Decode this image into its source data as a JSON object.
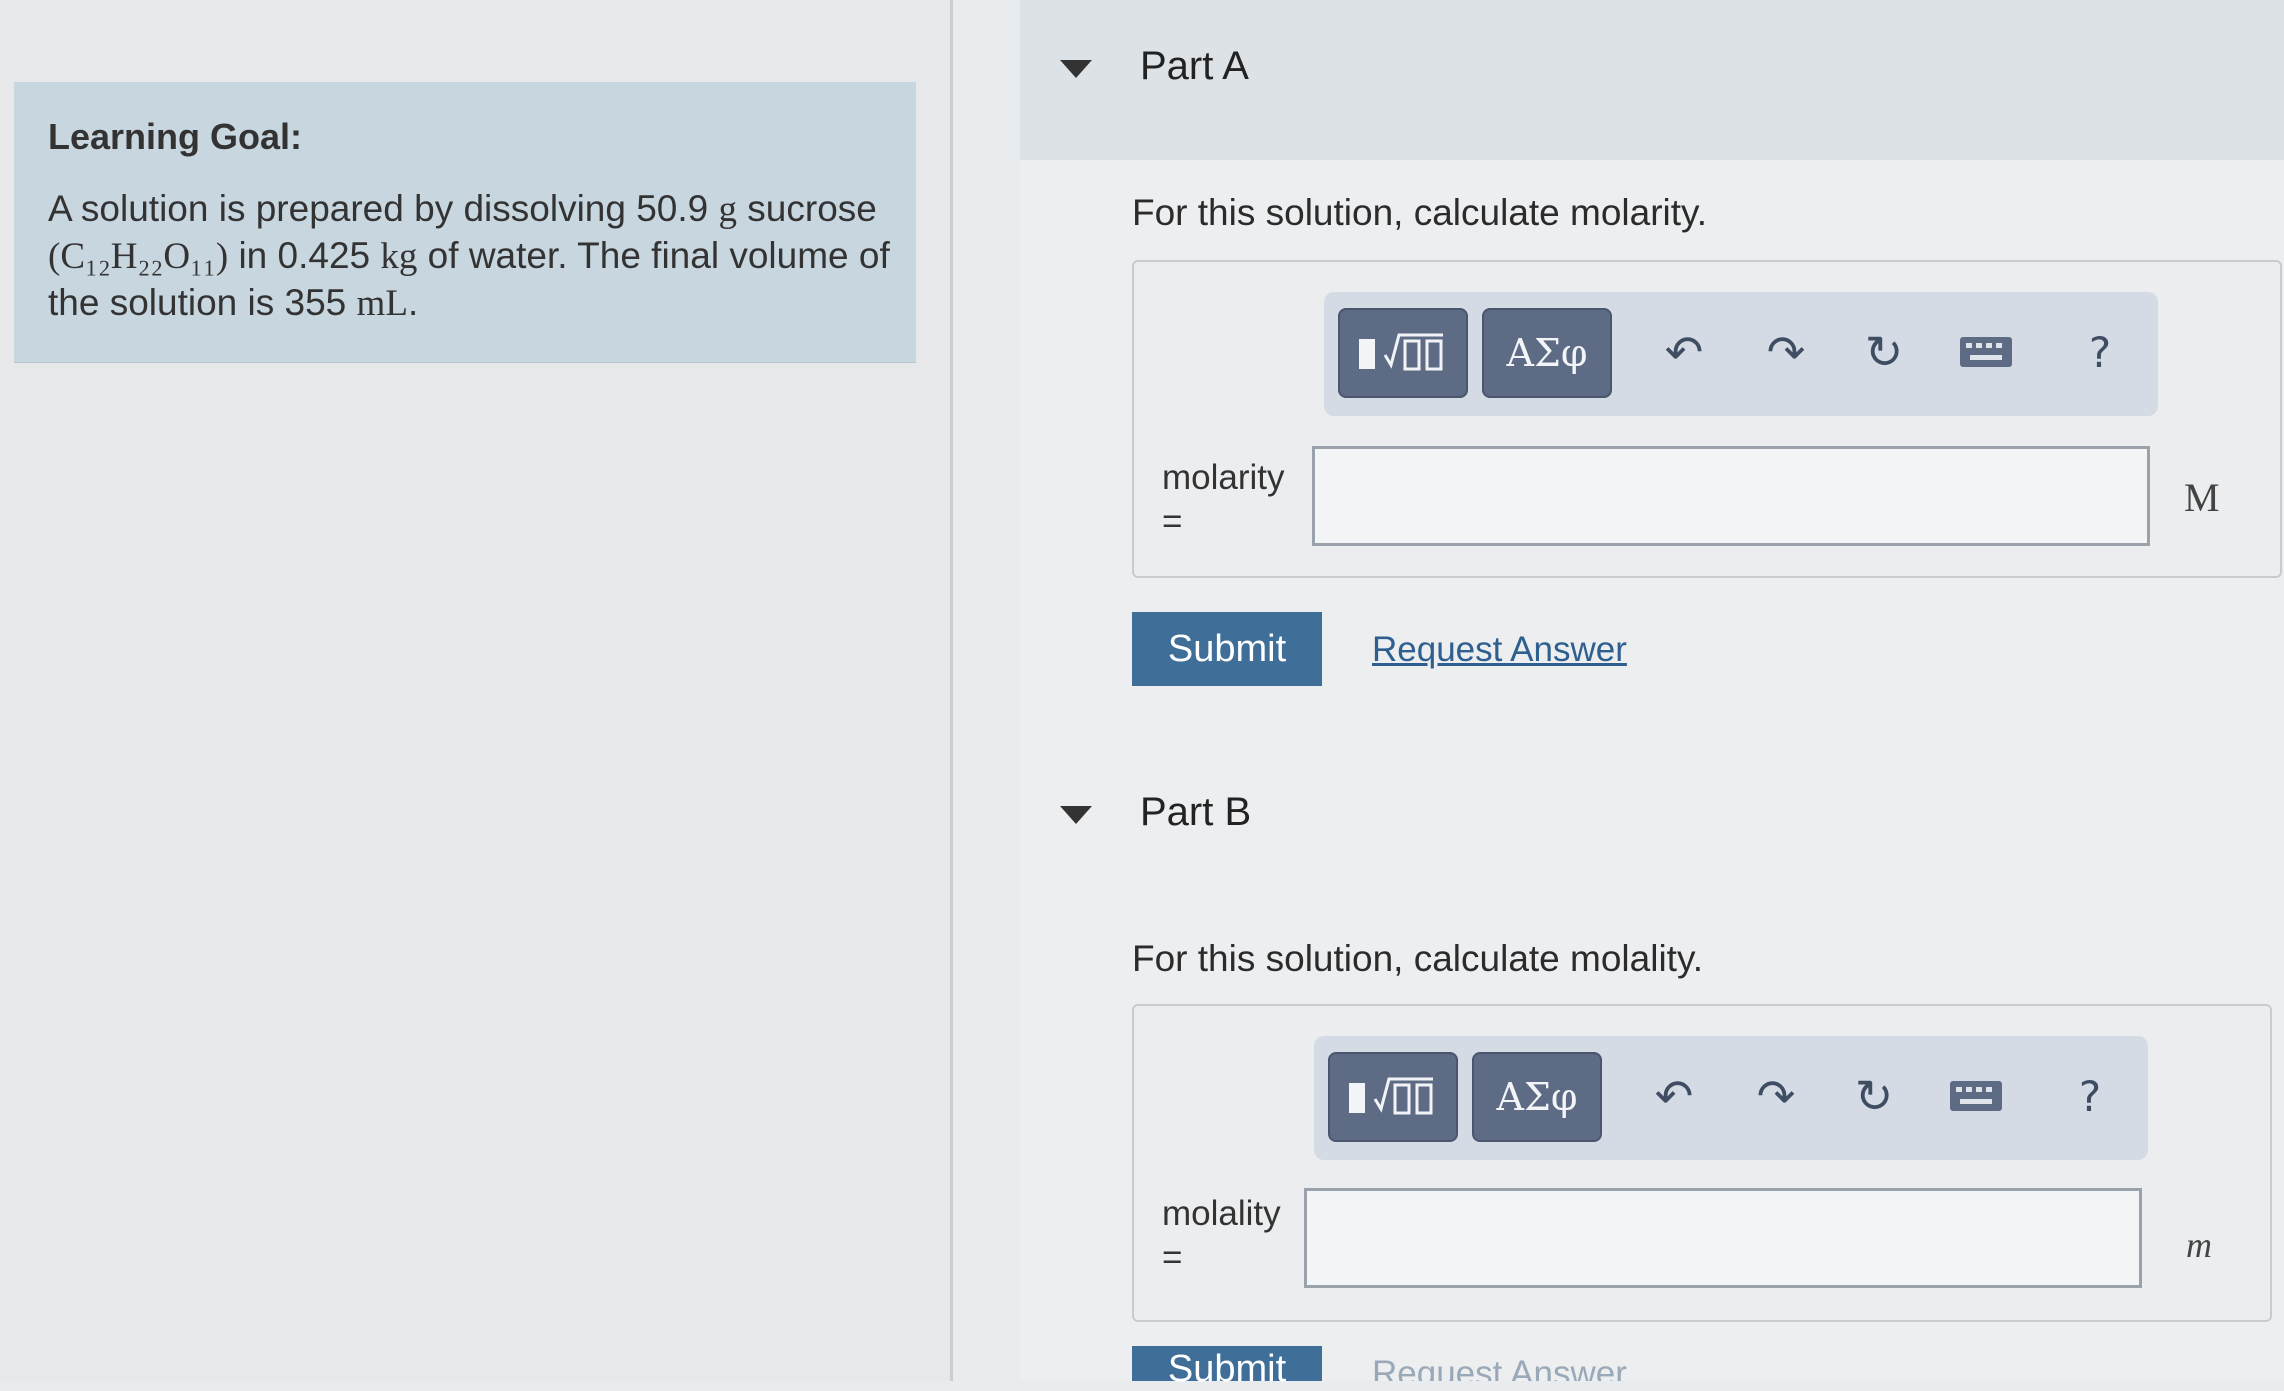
{
  "learning_goal": {
    "title": "Learning Goal:",
    "text_1": "A solution is prepared by dissolving 50.9 ",
    "unit_g": "g",
    "text_2": " sucrose",
    "formula": "(C₁₂H₂₂O₁₁)",
    "text_3": " in 0.425 ",
    "unit_kg": "kg",
    "text_4": " of water. The final volume of the solution is 355 ",
    "unit_ml": "mL",
    "text_5": "."
  },
  "part_a": {
    "title": "Part A",
    "prompt": "For this solution, calculate molarity.",
    "toolbar": {
      "symbols_label": "ΑΣφ",
      "help_label": "?"
    },
    "field_label_1": "molarity",
    "field_label_2": "=",
    "input_value": "",
    "unit": "M",
    "submit_label": "Submit",
    "request_label": "Request Answer"
  },
  "part_b": {
    "title": "Part B",
    "prompt": "For this solution, calculate molality.",
    "toolbar": {
      "symbols_label": "ΑΣφ",
      "help_label": "?"
    },
    "field_label_1": "molality",
    "field_label_2": "=",
    "input_value": "",
    "unit": "m",
    "submit_label": "Submit",
    "request_label": "Request Answer"
  },
  "icons": [
    "templates-icon",
    "undo-icon",
    "redo-icon",
    "reset-icon",
    "keyboard-icon",
    "help-icon",
    "caret-down-icon"
  ]
}
